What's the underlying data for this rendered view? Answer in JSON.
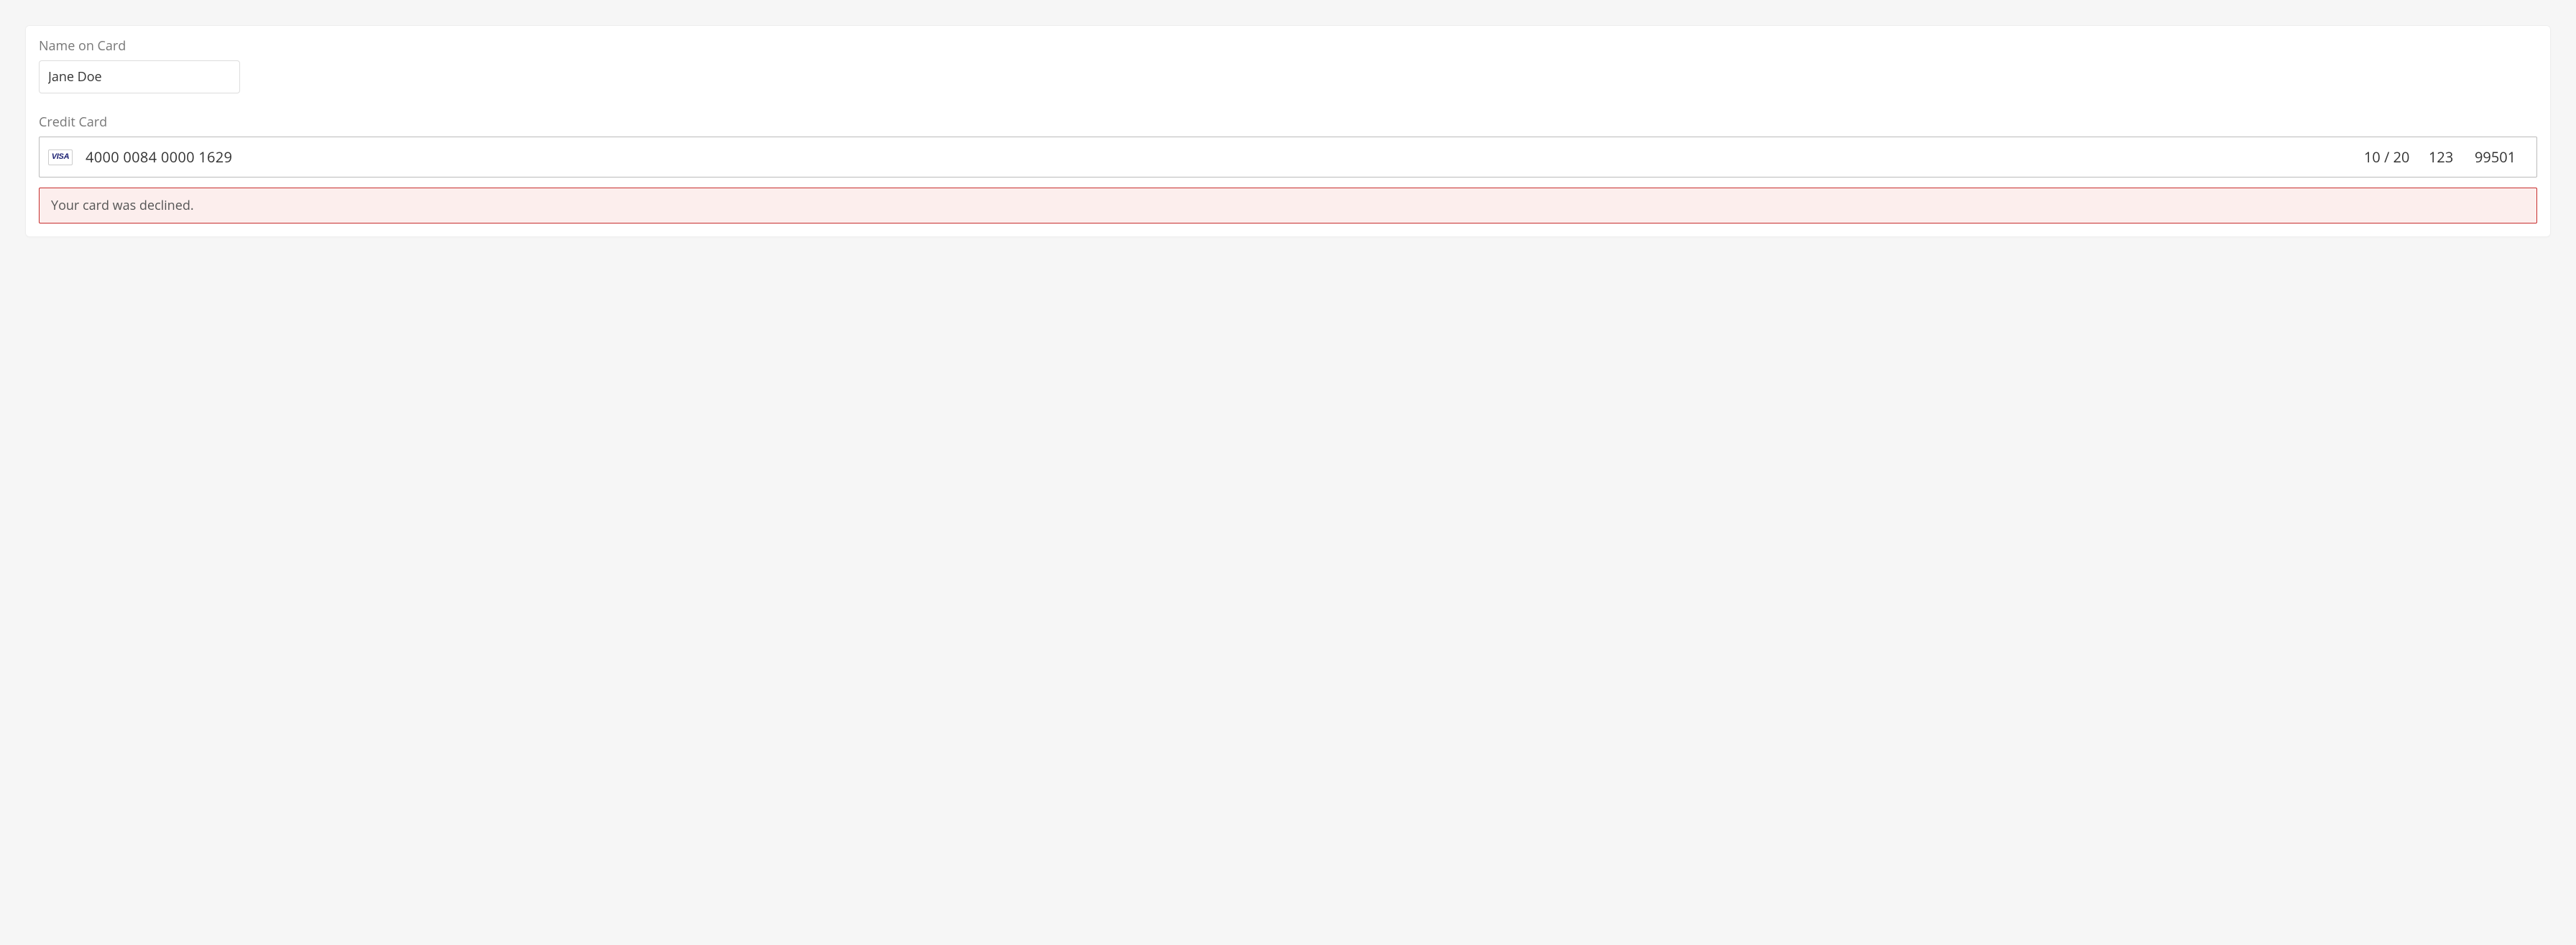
{
  "form": {
    "name_label": "Name on Card",
    "name_value": "Jane Doe",
    "cc_label": "Credit Card",
    "card_brand": "VISA",
    "card_number": "4000 0084 0000 1629",
    "card_expiry": "10 / 20",
    "card_cvc": "123",
    "card_zip": "99501"
  },
  "error": {
    "message": "Your card was declined."
  }
}
